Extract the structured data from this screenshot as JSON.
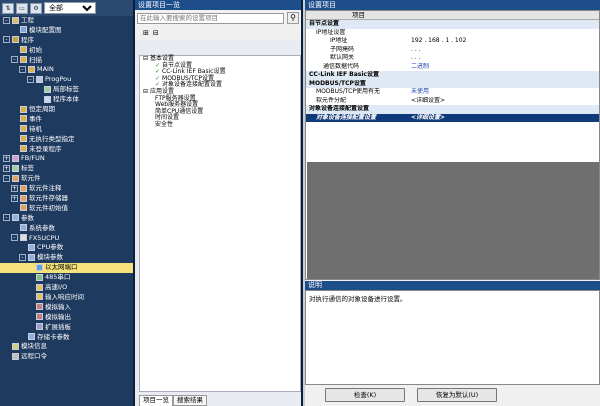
{
  "left": {
    "toolbar_filter": "全部",
    "tree": [
      {
        "label": "工程",
        "level": 0,
        "exp": "-",
        "icon": "project-icon",
        "sel": false
      },
      {
        "label": "模块配置图",
        "level": 1,
        "exp": "",
        "icon": "module-config-icon",
        "sel": false
      },
      {
        "label": "程序",
        "level": 0,
        "exp": "-",
        "icon": "program-icon",
        "sel": false
      },
      {
        "label": "初始",
        "level": 1,
        "exp": "",
        "icon": "folder-icon",
        "sel": false
      },
      {
        "label": "扫描",
        "level": 1,
        "exp": "-",
        "icon": "folder-icon",
        "sel": false
      },
      {
        "label": "MAIN",
        "level": 2,
        "exp": "-",
        "icon": "folder-icon",
        "sel": false
      },
      {
        "label": "ProgPou",
        "level": 3,
        "exp": "-",
        "icon": "pou-icon",
        "sel": false
      },
      {
        "label": "局部标签",
        "level": 4,
        "exp": "",
        "icon": "label-icon",
        "sel": false
      },
      {
        "label": "程序本体",
        "level": 4,
        "exp": "",
        "icon": "program-body-icon",
        "sel": false
      },
      {
        "label": "恒定周期",
        "level": 1,
        "exp": "",
        "icon": "folder-icon",
        "sel": false
      },
      {
        "label": "事件",
        "level": 1,
        "exp": "",
        "icon": "folder-icon",
        "sel": false
      },
      {
        "label": "待机",
        "level": 1,
        "exp": "",
        "icon": "folder-icon",
        "sel": false
      },
      {
        "label": "无执行类型指定",
        "level": 1,
        "exp": "",
        "icon": "folder-icon",
        "sel": false
      },
      {
        "label": "未登录程序",
        "level": 1,
        "exp": "",
        "icon": "folder-icon",
        "sel": false
      },
      {
        "label": "FB/FUN",
        "level": 0,
        "exp": "+",
        "icon": "fb-icon",
        "sel": false
      },
      {
        "label": "标签",
        "level": 0,
        "exp": "+",
        "icon": "label-icon",
        "sel": false
      },
      {
        "label": "软元件",
        "level": 0,
        "exp": "-",
        "icon": "device-icon",
        "sel": false
      },
      {
        "label": "软元件注释",
        "level": 1,
        "exp": "+",
        "icon": "device-icon",
        "sel": false
      },
      {
        "label": "软元件存储器",
        "level": 1,
        "exp": "+",
        "icon": "device-icon",
        "sel": false
      },
      {
        "label": "软元件初始值",
        "level": 1,
        "exp": "",
        "icon": "device-icon",
        "sel": false
      },
      {
        "label": "参数",
        "level": 0,
        "exp": "-",
        "icon": "parameter-icon",
        "sel": false
      },
      {
        "label": "系统参数",
        "level": 1,
        "exp": "",
        "icon": "parameter-icon",
        "sel": false
      },
      {
        "label": "FX5UCPU",
        "level": 1,
        "exp": "-",
        "icon": "cpu-icon",
        "sel": false
      },
      {
        "label": "CPU参数",
        "level": 2,
        "exp": "",
        "icon": "parameter-icon",
        "sel": false
      },
      {
        "label": "模块参数",
        "level": 2,
        "exp": "-",
        "icon": "parameter-icon",
        "sel": false
      },
      {
        "label": "以太网端口",
        "level": 3,
        "exp": "",
        "icon": "ethernet-icon",
        "sel": true
      },
      {
        "label": "485串口",
        "level": 3,
        "exp": "",
        "icon": "serial-icon",
        "sel": false
      },
      {
        "label": "高速I/O",
        "level": 3,
        "exp": "",
        "icon": "io-icon",
        "sel": false
      },
      {
        "label": "输入响应时间",
        "level": 3,
        "exp": "",
        "icon": "io-icon",
        "sel": false
      },
      {
        "label": "模拟输入",
        "level": 3,
        "exp": "",
        "icon": "analog-icon",
        "sel": false
      },
      {
        "label": "模拟输出",
        "level": 3,
        "exp": "",
        "icon": "analog-icon",
        "sel": false
      },
      {
        "label": "扩展插板",
        "level": 3,
        "exp": "",
        "icon": "board-icon",
        "sel": false
      },
      {
        "label": "存储卡参数",
        "level": 2,
        "exp": "",
        "icon": "parameter-icon",
        "sel": false
      },
      {
        "label": "模块信息",
        "level": 0,
        "exp": "",
        "icon": "module-icon",
        "sel": false
      },
      {
        "label": "远程口令",
        "level": 0,
        "exp": "",
        "icon": "lock-icon",
        "sel": false
      }
    ]
  },
  "mid": {
    "title": "设置项目一览",
    "search_placeholder": "在此输入要搜索的设置项目",
    "tree": [
      {
        "label": "基本设置",
        "level": 0,
        "exp": "-",
        "check": false
      },
      {
        "label": "自节点设置",
        "level": 1,
        "exp": "",
        "check": true
      },
      {
        "label": "CC-Link IEF Basic设置",
        "level": 1,
        "exp": "",
        "check": true
      },
      {
        "label": "MODBUS/TCP设置",
        "level": 1,
        "exp": "",
        "check": true
      },
      {
        "label": "对象设备连接配置设置",
        "level": 1,
        "exp": "",
        "check": true
      },
      {
        "label": "应用设置",
        "level": 0,
        "exp": "-",
        "check": false
      },
      {
        "label": "FTP服务器设置",
        "level": 1,
        "exp": "",
        "check": false
      },
      {
        "label": "Web服务器设置",
        "level": 1,
        "exp": "",
        "check": false
      },
      {
        "label": "简单CPU通信设置",
        "level": 1,
        "exp": "",
        "check": false
      },
      {
        "label": "时间设置",
        "level": 1,
        "exp": "",
        "check": false
      },
      {
        "label": "安全性",
        "level": 1,
        "exp": "",
        "check": false
      }
    ],
    "tabs": [
      "项目一览",
      "搜索结果"
    ]
  },
  "right": {
    "title": "设置项目",
    "grid_header": "项目",
    "rows": [
      {
        "name": "自节点设置",
        "value": "",
        "indent": 0,
        "type": "group"
      },
      {
        "name": "IP地址设置",
        "value": "",
        "indent": 1,
        "type": "sub"
      },
      {
        "name": "IP地址",
        "value": "192 . 168 .   1 . 102",
        "indent": 3,
        "type": "item"
      },
      {
        "name": "子网掩码",
        "value": "  .     .     .",
        "indent": 3,
        "type": "item"
      },
      {
        "name": "默认网关",
        "value": "  .     .     .",
        "indent": 3,
        "type": "item"
      },
      {
        "name": "通信数据代码",
        "value": "二进制",
        "indent": 2,
        "type": "item"
      },
      {
        "name": "CC-Link IEF Basic设置",
        "value": "",
        "indent": 0,
        "type": "group"
      },
      {
        "name": "MODBUS/TCP设置",
        "value": "",
        "indent": 0,
        "type": "group"
      },
      {
        "name": "MODBUS/TCP使用有无",
        "value": "未使用",
        "indent": 1,
        "type": "item"
      },
      {
        "name": "软元件分配",
        "value": "<详细设置>",
        "indent": 1,
        "type": "item"
      },
      {
        "name": "对象设备连接配置设置",
        "value": "",
        "indent": 0,
        "type": "group"
      },
      {
        "name": "对象设备连接配置设置",
        "value": "<详细设置>",
        "indent": 1,
        "type": "hl"
      }
    ],
    "desc_title": "说明",
    "desc_text": "对执行通信的对象设备进行设置。",
    "check_button": "检查(K)",
    "restore_button": "恢复为默认(U)"
  },
  "watermark": "发布于 gongkong®"
}
